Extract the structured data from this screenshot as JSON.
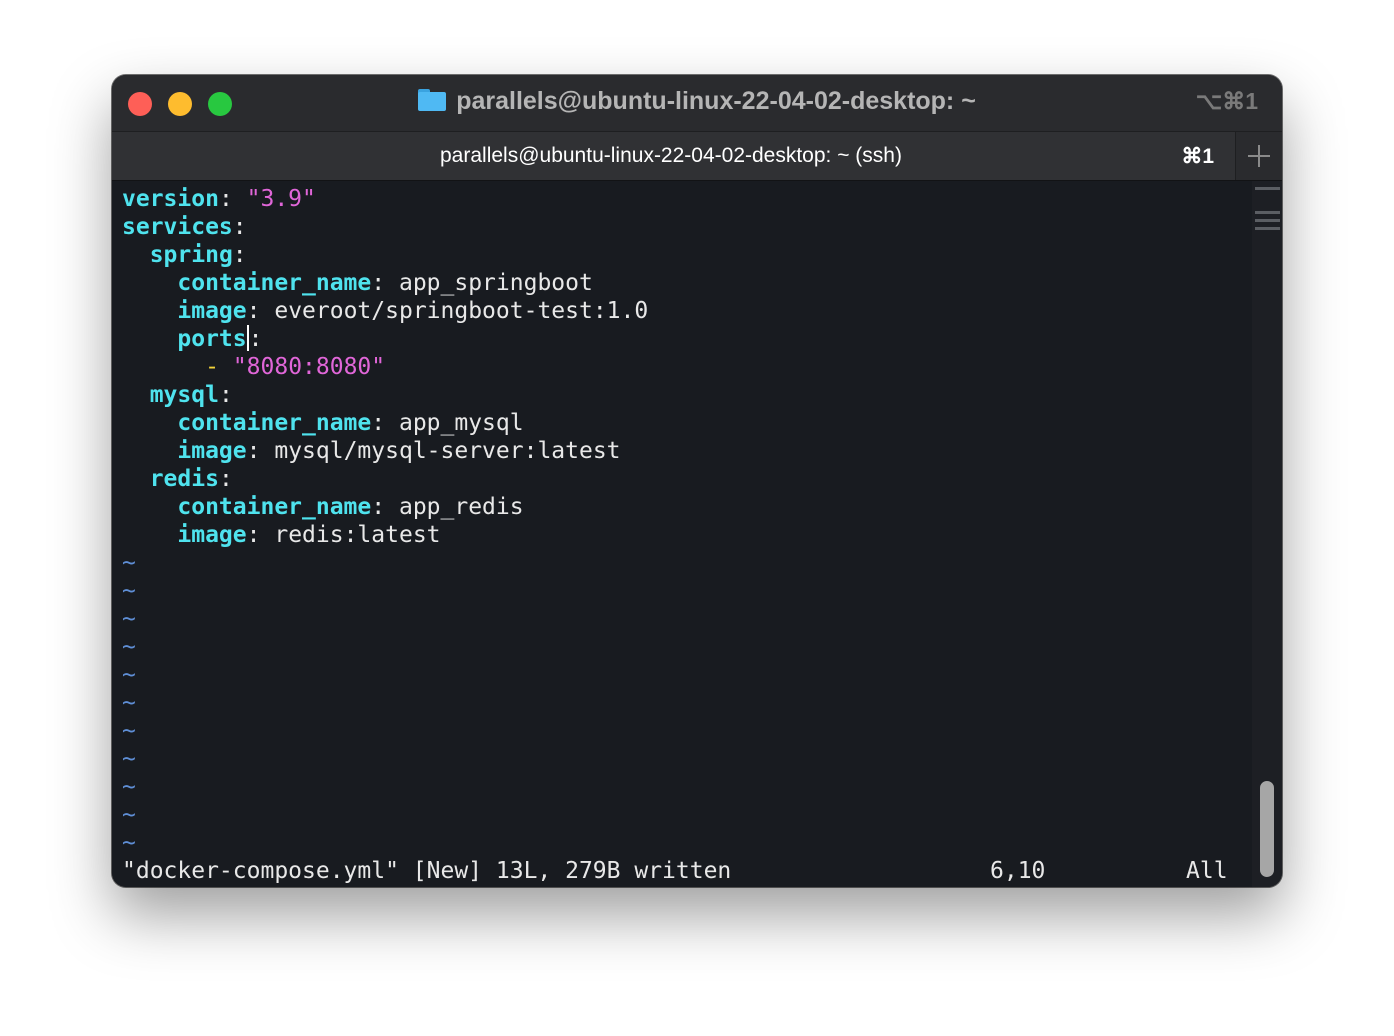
{
  "window": {
    "title": "parallels@ubuntu-linux-22-04-02-desktop: ~",
    "window_shortcut": "⌥⌘1",
    "tab": {
      "label": "parallels@ubuntu-linux-22-04-02-desktop: ~ (ssh)",
      "shortcut": "⌘1"
    }
  },
  "editor": {
    "lines": [
      {
        "key": "version",
        "value": "\"3.9\""
      },
      {
        "key": "services"
      },
      {
        "key": "spring"
      },
      {
        "key": "container_name",
        "value": "app_springboot"
      },
      {
        "key": "image",
        "value": "everoot/springboot-test:1.0"
      },
      {
        "key": "ports"
      },
      {
        "dash": "-",
        "value": "\"8080:8080\""
      },
      {
        "key": "mysql"
      },
      {
        "key": "container_name",
        "value": "app_mysql"
      },
      {
        "key": "image",
        "value": "mysql/mysql-server:latest"
      },
      {
        "key": "redis"
      },
      {
        "key": "container_name",
        "value": "app_redis"
      },
      {
        "key": "image",
        "value": "redis:latest"
      }
    ],
    "empty_marker": "~",
    "status": {
      "message": "\"docker-compose.yml\" [New] 13L, 279B written",
      "position": "6,10",
      "scroll": "All"
    }
  },
  "colors": {
    "key": "#4fe3ee",
    "string": "#e066d8",
    "dash": "#f2d33a",
    "tilde": "#5f8fd6"
  }
}
